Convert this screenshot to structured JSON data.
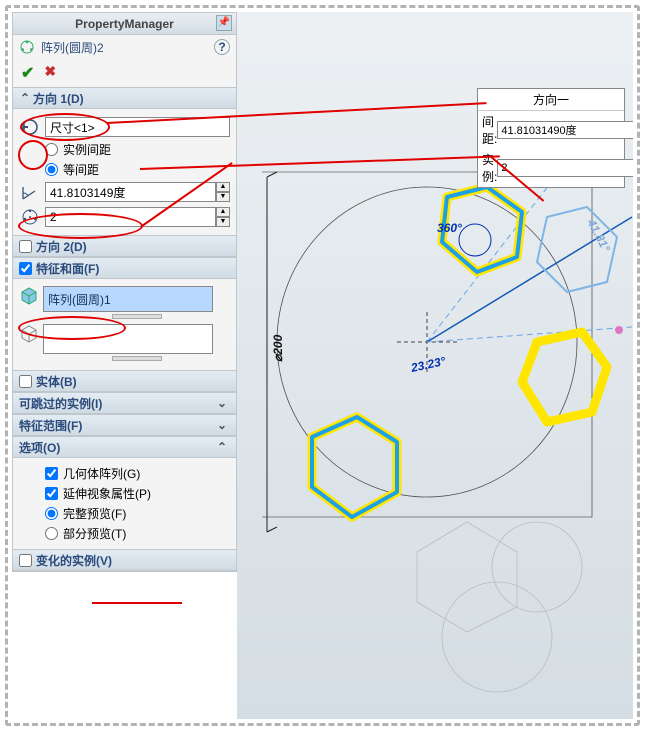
{
  "header": {
    "title": "PropertyManager"
  },
  "feature": {
    "name": "阵列(圆周)2"
  },
  "dir1": {
    "title": "方向 1(D)",
    "axis": "尺寸<1>",
    "opt_spacing": "实例间距",
    "opt_equal": "等间距",
    "angle": "41.8103149度",
    "count": "2"
  },
  "dir2": {
    "title": "方向 2(D)"
  },
  "featFace": {
    "title": "特征和面(F)",
    "item": "阵列(圆周)1"
  },
  "bodies": {
    "title": "实体(B)"
  },
  "skip": {
    "title": "可跳过的实例(I)"
  },
  "scope": {
    "title": "特征范围(F)"
  },
  "options": {
    "title": "选项(O)",
    "geom": "几何体阵列(G)",
    "propagate": "延伸视象属性(P)",
    "full": "完整预览(F)",
    "partial": "部分预览(T)"
  },
  "varied": {
    "title": "变化的实例(V)"
  },
  "callout": {
    "title": "方向一",
    "spacing_label": "间距:",
    "spacing_value": "41.81031490度",
    "inst_label": "实例:",
    "inst_value": "2"
  },
  "cad": {
    "diam": "⌀200",
    "ang360": "360°",
    "ang23": "23.23°",
    "ang41": "41.81°"
  }
}
